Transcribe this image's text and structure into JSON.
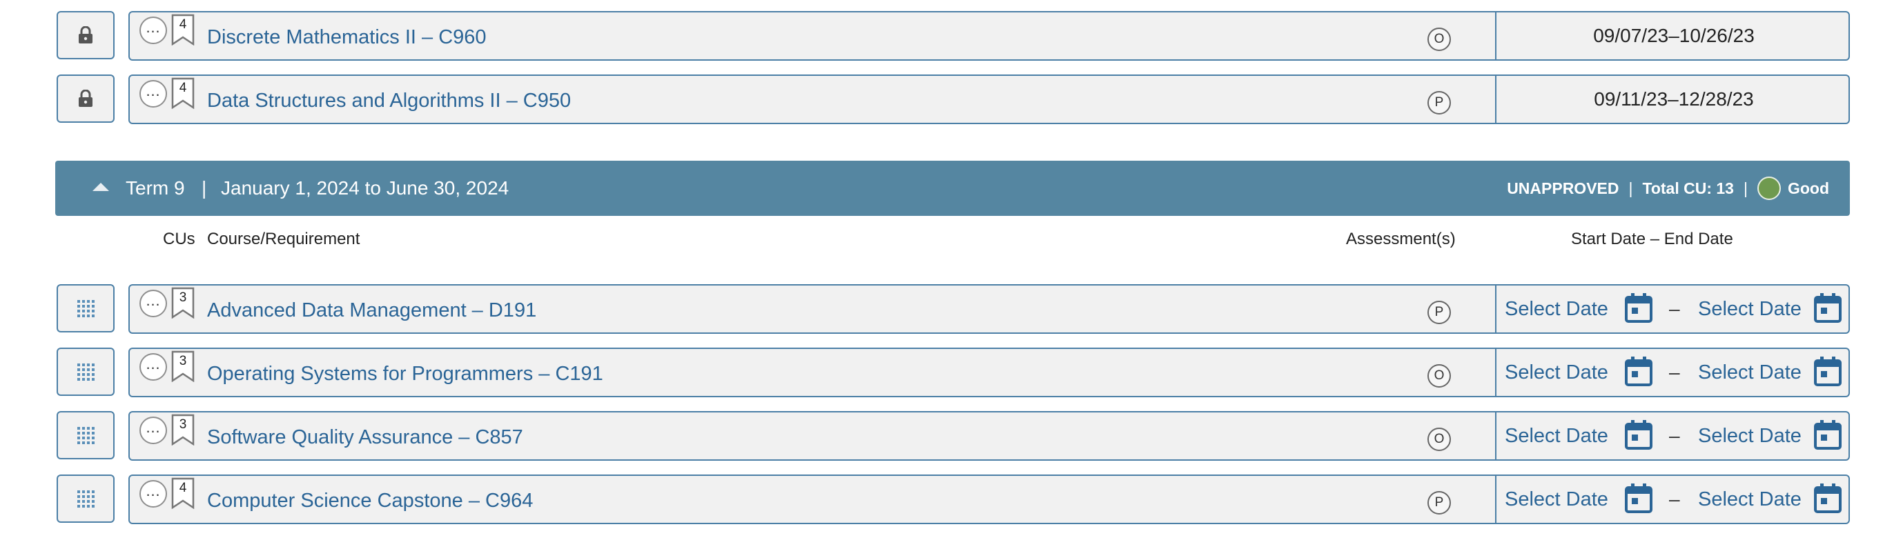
{
  "completed_courses": [
    {
      "cu": "4",
      "title": "Discrete Mathematics II – C960",
      "assessment": "O",
      "dates": "09/07/23–10/26/23"
    },
    {
      "cu": "4",
      "title": "Data Structures and Algorithms II – C950",
      "assessment": "P",
      "dates": "09/11/23–12/28/23"
    }
  ],
  "term": {
    "title": "Term 9",
    "separator": "|",
    "dates": "January 1, 2024 to June 30, 2024",
    "status": "UNAPPROVED",
    "pipe": "|",
    "total_cu": "Total CU: 13",
    "standing": "Good",
    "standing_color": "#6f9a4f"
  },
  "columns": {
    "cus": "CUs",
    "course": "Course/Requirement",
    "assessments": "Assessment(s)",
    "dates": "Start Date – End Date"
  },
  "term_courses": [
    {
      "cu": "3",
      "title": "Advanced Data Management – D191",
      "assessment": "P",
      "start": "Select Date",
      "dash": "–",
      "end": "Select Date"
    },
    {
      "cu": "3",
      "title": "Operating Systems for Programmers – C191",
      "assessment": "O",
      "start": "Select Date",
      "dash": "–",
      "end": "Select Date"
    },
    {
      "cu": "3",
      "title": "Software Quality Assurance – C857",
      "assessment": "O",
      "start": "Select Date",
      "dash": "–",
      "end": "Select Date"
    },
    {
      "cu": "4",
      "title": "Computer Science Capstone – C964",
      "assessment": "P",
      "start": "Select Date",
      "dash": "–",
      "end": "Select Date"
    }
  ],
  "icons": {
    "locked": "lock-icon",
    "drag": "drag-grid-icon",
    "more": "more-options-icon",
    "cu": "bookmark-icon",
    "calendar": "calendar-icon",
    "collapse": "caret-up-icon"
  },
  "colors": {
    "accent": "#2a6496",
    "term_bar": "#5586a1",
    "border": "#4b7fa6"
  }
}
